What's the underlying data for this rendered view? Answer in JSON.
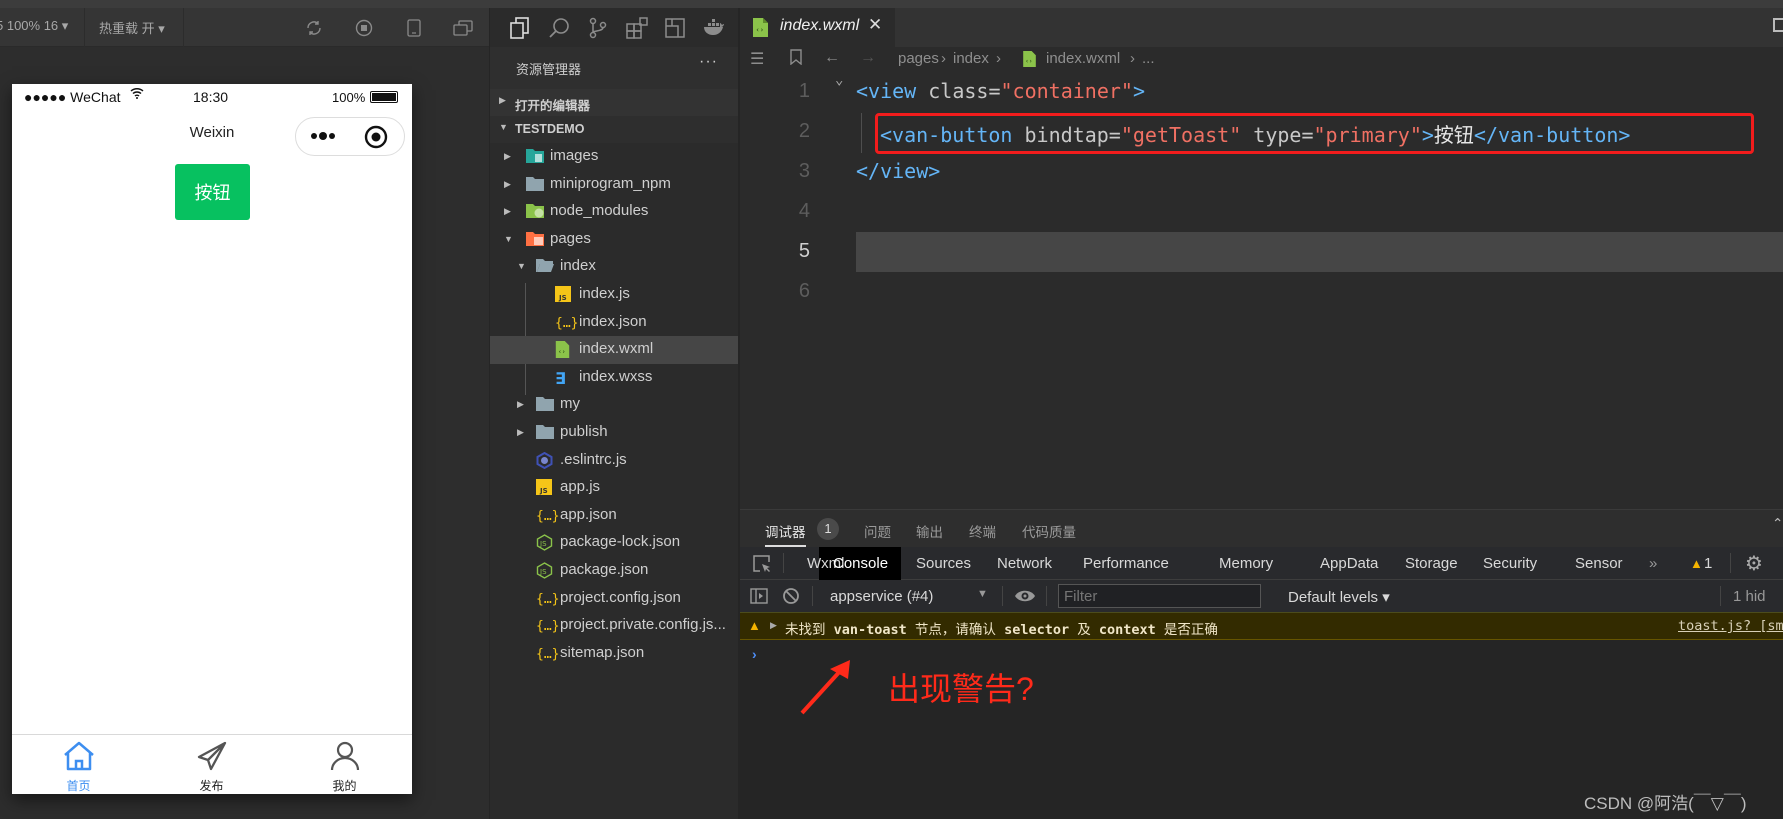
{
  "simulator": {
    "toolbar": {
      "device_zoom": "5 100% 16 ▾",
      "hot_reload": "热重载 开 ▾",
      "icons": [
        "refresh-icon",
        "stop-icon",
        "phone-icon",
        "window-icon"
      ]
    },
    "status_bar": {
      "carrier": "●●●●● WeChat",
      "time": "18:30",
      "battery": "100%"
    },
    "nav_title": "Weixin",
    "button_label": "按钮",
    "tabbar": [
      {
        "label": "首页",
        "icon": "home-icon",
        "active": true
      },
      {
        "label": "发布",
        "icon": "send-icon",
        "active": false
      },
      {
        "label": "我的",
        "icon": "user-icon",
        "active": false
      }
    ],
    "colors": {
      "button": "#07c160",
      "tab_active": "#3d8ef0"
    }
  },
  "explorer": {
    "title": "资源管理器",
    "more": "···",
    "sections": {
      "open_editors": "打开的编辑器",
      "project": "TESTDEMO"
    },
    "tree": [
      {
        "name": "images",
        "type": "folder",
        "icon": "images-folder",
        "expanded": false,
        "depth": 0
      },
      {
        "name": "miniprogram_npm",
        "type": "folder",
        "icon": "folder",
        "expanded": false,
        "depth": 0
      },
      {
        "name": "node_modules",
        "type": "folder",
        "icon": "node-folder",
        "expanded": false,
        "depth": 0
      },
      {
        "name": "pages",
        "type": "folder",
        "icon": "pages-folder",
        "expanded": true,
        "depth": 0
      },
      {
        "name": "index",
        "type": "folder",
        "icon": "folder-open",
        "expanded": true,
        "depth": 1
      },
      {
        "name": "index.js",
        "type": "file",
        "icon": "js",
        "depth": 2
      },
      {
        "name": "index.json",
        "type": "file",
        "icon": "json",
        "depth": 2
      },
      {
        "name": "index.wxml",
        "type": "file",
        "icon": "wxml",
        "depth": 2,
        "selected": true
      },
      {
        "name": "index.wxss",
        "type": "file",
        "icon": "wxss",
        "depth": 2
      },
      {
        "name": "my",
        "type": "folder",
        "icon": "folder",
        "expanded": false,
        "depth": 1
      },
      {
        "name": "publish",
        "type": "folder",
        "icon": "folder",
        "expanded": false,
        "depth": 1
      },
      {
        "name": ".eslintrc.js",
        "type": "file",
        "icon": "eslint",
        "depth": 0
      },
      {
        "name": "app.js",
        "type": "file",
        "icon": "js",
        "depth": 0
      },
      {
        "name": "app.json",
        "type": "file",
        "icon": "json",
        "depth": 0
      },
      {
        "name": "package-lock.json",
        "type": "file",
        "icon": "node",
        "depth": 0
      },
      {
        "name": "package.json",
        "type": "file",
        "icon": "node",
        "depth": 0
      },
      {
        "name": "project.config.json",
        "type": "file",
        "icon": "json",
        "depth": 0
      },
      {
        "name": "project.private.config.js...",
        "type": "file",
        "icon": "json",
        "depth": 0
      },
      {
        "name": "sitemap.json",
        "type": "file",
        "icon": "json",
        "depth": 0
      }
    ]
  },
  "editor": {
    "tab": {
      "name": "index.wxml"
    },
    "breadcrumb": [
      "pages",
      "index",
      "index.wxml",
      "..."
    ],
    "current_line": 5,
    "lines": [
      {
        "n": "1",
        "tokens": [
          [
            "tagc",
            "<view "
          ],
          [
            "attr",
            "class="
          ],
          [
            "str",
            "\"container\""
          ],
          [
            "tagc",
            ">"
          ]
        ]
      },
      {
        "n": "2",
        "tokens": [
          [
            "tagc",
            "<van-button "
          ],
          [
            "attr",
            "bindtap="
          ],
          [
            "str",
            "\"getToast\""
          ],
          [
            "attr",
            " type="
          ],
          [
            "str",
            "\"primary\""
          ],
          [
            "tagc",
            ">"
          ],
          [
            "txtc",
            "按钮"
          ],
          [
            "tagc",
            "</van-button>"
          ]
        ]
      },
      {
        "n": "3",
        "tokens": [
          [
            "tagc",
            "</view>"
          ]
        ]
      },
      {
        "n": "4",
        "tokens": []
      },
      {
        "n": "5",
        "tokens": []
      },
      {
        "n": "6",
        "tokens": []
      }
    ]
  },
  "debugger": {
    "panel_tabs": [
      "调试器",
      "问题",
      "输出",
      "终端",
      "代码质量"
    ],
    "badge": "1",
    "devtools_tabs": [
      "Wxml",
      "Console",
      "Sources",
      "Network",
      "Performance",
      "Memory",
      "AppData",
      "Storage",
      "Security",
      "Sensor"
    ],
    "active_devtool": "Console",
    "more": "»",
    "warning_count": "1",
    "context": "appservice (#4)",
    "filter_placeholder": "Filter",
    "levels": "Default levels ▾",
    "hidden": "1 hid",
    "warning": {
      "parts": [
        "未找到 ",
        "van-toast",
        " 节点，请确认 ",
        "selector",
        " 及 ",
        "context",
        " 是否正确"
      ],
      "source": "toast.js? [sm"
    },
    "prompt": "›"
  },
  "annotation": {
    "text": "出现警告?",
    "color": "#ff2a1a"
  },
  "watermark": "CSDN @阿浩(￣▽￣)"
}
